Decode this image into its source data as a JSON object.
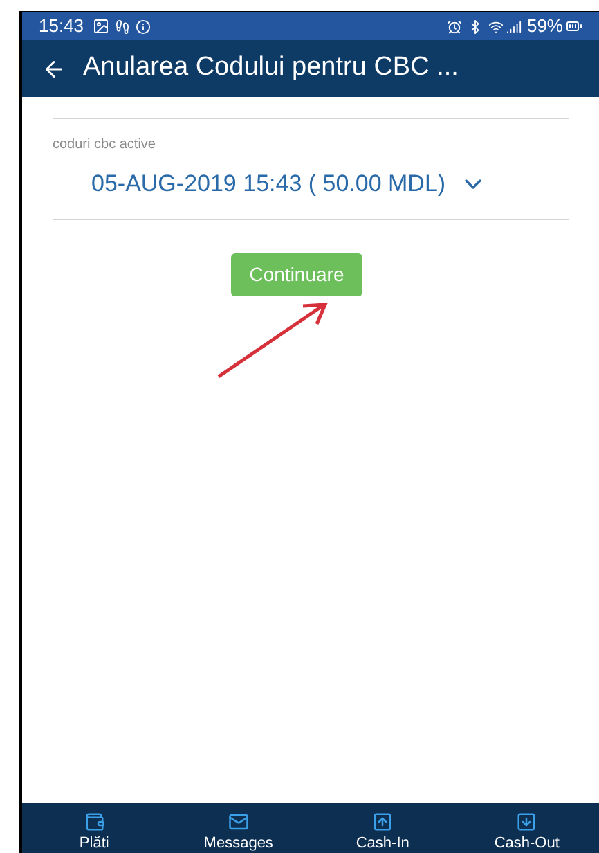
{
  "status_bar": {
    "time": "15:43",
    "battery": "59%"
  },
  "header": {
    "title": "Anularea Codului pentru CBC ..."
  },
  "field": {
    "label": "coduri cbc active",
    "value": "05-AUG-2019 15:43 ( 50.00 MDL)"
  },
  "button": {
    "label": "Continuare"
  },
  "bottom_nav": [
    {
      "label": "Plăti"
    },
    {
      "label": "Messages"
    },
    {
      "label": "Cash-In"
    },
    {
      "label": "Cash-Out"
    }
  ]
}
